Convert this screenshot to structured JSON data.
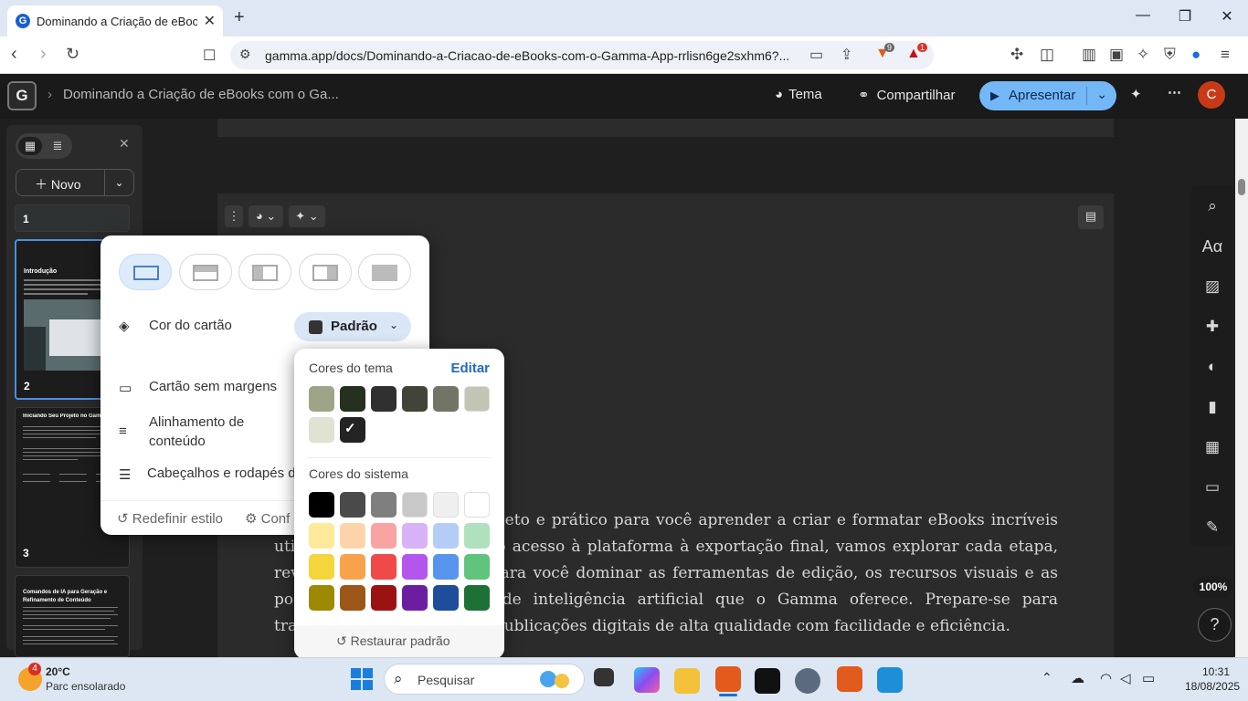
{
  "browser": {
    "tab_title": "Dominando a Criação de eBooks",
    "url": "gamma.app/docs/Dominando-a-Criacao-de-eBooks-com-o-Gamma-App-rrlisn6ge2sxhm6?...",
    "brave_badge": "9",
    "alert_badge": "1"
  },
  "app": {
    "breadcrumb": "Dominando a Criação de eBooks com o Ga...",
    "theme_label": "Tema",
    "share_label": "Compartilhar",
    "present_label": "Apresentar",
    "avatar_initial": "C"
  },
  "sidebar": {
    "new_label": "Novo",
    "thumbs": [
      {
        "num": "1",
        "title": ""
      },
      {
        "num": "2",
        "title": "Introdução"
      },
      {
        "num": "3",
        "title": "Iniciando Seu Projeto no Gamma"
      },
      {
        "num": "",
        "title": "Comandos de IA para Geração e Refinamento de Conteúdo"
      }
    ]
  },
  "card_style": {
    "card_color_label": "Cor do cartão",
    "card_color_value": "Padrão",
    "no_margin_label": "Cartão sem margens",
    "alignment_label": "Alinhamento de conteúdo",
    "headers_label": "Cabeçalhos e rodapés d",
    "reset_label": "Redefinir estilo",
    "config_label": "Conf"
  },
  "color_picker": {
    "theme_colors_label": "Cores do tema",
    "edit_label": "Editar",
    "system_colors_label": "Cores do sistema",
    "restore_label": "Restaurar padrão",
    "theme_colors": [
      "#9ea487",
      "#25301f",
      "#303030",
      "#434439",
      "#727466",
      "#c2c5b4",
      "#dfe3d0",
      "#232323"
    ],
    "system_colors": [
      [
        "#000000",
        "#4a4a4a",
        "#7f7f7f",
        "#c8c8c8",
        "#efefef",
        "#ffffff"
      ],
      [
        "#fde99a",
        "#fdd4aa",
        "#f9a3a3",
        "#d8b2f6",
        "#b4cdf6",
        "#b0e1bf"
      ],
      [
        "#f5d53c",
        "#f8a24c",
        "#ef4a4a",
        "#b356ee",
        "#5795ed",
        "#60c47c"
      ],
      [
        "#9e8904",
        "#9c5617",
        "#9c1212",
        "#6b1fa0",
        "#1e4e9b",
        "#1d7136"
      ]
    ]
  },
  "document": {
    "paragraph": "Este eBook é um guia completo e prático para você aprender a criar e formatar eBooks incríveis utilizando o Gamma App. Do acesso à plataforma à exportação final, vamos explorar cada etapa, revelando dicas e truques para você dominar as ferramentas de edição, os recursos visuais e as poderosas funcionalidades de inteligência artificial que o Gamma oferece. Prepare-se para transformar suas ideias em publicações digitais de alta qualidade com facilidade e eficiência."
  },
  "zoom": "100%",
  "taskbar": {
    "weather_temp": "20°C",
    "weather_desc": "Parc ensolarado",
    "weather_badge": "4",
    "search_placeholder": "Pesquisar",
    "time": "10:31",
    "date": "18/08/2025"
  }
}
